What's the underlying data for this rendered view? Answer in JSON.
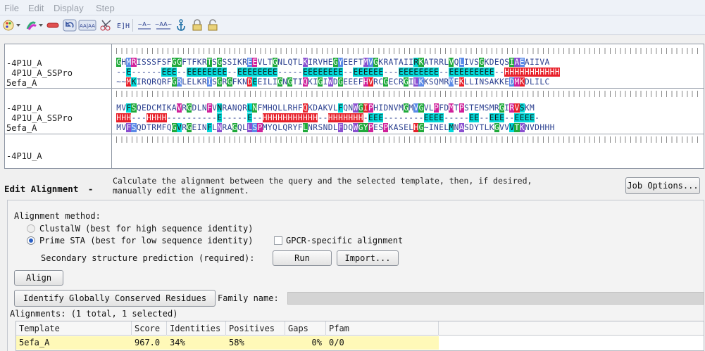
{
  "menu": [
    "File",
    "Edit",
    "Display",
    "Step"
  ],
  "toolbar": {
    "icons": [
      "palette-icon",
      "color-scheme-icon",
      "minus-link-icon",
      "undo-icon",
      "aa-hyphen-icon",
      "scissors-icon",
      "bracket-text-icon",
      "align-gap-icon",
      "align-gap2-icon",
      "anchor-icon",
      "lock-icon",
      "unlock-icon"
    ],
    "labels": {
      "aaaa": "AA|AA",
      "eh": "E]H",
      "ar1": "~A~",
      "ar2": "~AA~"
    }
  },
  "sequence_panel": {
    "blocks": [
      {
        "names": [
          "-4P1U_A",
          " 4P1U_A_SSPro",
          "5efa_A"
        ],
        "rows": [
          "GHMRISSSFSFGGFTFKRTSGSSIKREEVLTGNLQTLKIRVHEGYEEFTMVGKRATAIIRKATRRLVQLIVSGKDEQSIAEAIIVA",
          "--E------EEE--EEEEEEEE--EEEEEEEE-----EEEEEEEE--EEEEEE---EEEEEEEE--EEEEEEEEE--HHHHHHHHHHH",
          "~~MKIRQRQRFGRLELKRISGRGFKNDEEILIGNGTIQKIGIWDGEEEFHVRCGECRGILKKSQMRMEKLLINSAKKEDMKDLILC"
        ]
      },
      {
        "names": [
          "-4P1U_A",
          " 4P1U_A_SSPro",
          "5efa_A"
        ],
        "rows": [
          "MVFSQEDCMIKAVRGDLNFVNRANQRLNFMHQLLRHFQKDAKVLFQNWGIPHIDNVMGMVGVLPFDMTPSTEMSMRGIRVSKM",
          "HHH---HHHH----------E-----E--HHHHHHHHHHH--HHHHHHH-EEE--------EEEE-----EE--EEE--EEEE-",
          "MVFSQDTRMFQGVRGEINFLNRAGQLLSPMYQLQRYFLNRSNDLFDQWGYPESPKASELHG~INELMNASDYTLKGVVVTKNVDHHH"
        ]
      },
      {
        "names": [
          "-4P1U_A"
        ],
        "rows": []
      }
    ]
  },
  "edit_alignment": {
    "title": "Edit Alignment",
    "dash": "-",
    "description_line1": "Calculate the alignment between the query and the selected template, then, if desired,",
    "description_line2": "manually edit the alignment.",
    "job_options_label": "Job Options..."
  },
  "alignment_method": {
    "label": "Alignment method:",
    "options": [
      {
        "label": "ClustalW (best for high sequence identity)",
        "selected": false
      },
      {
        "label": "Prime STA (best for low sequence identity)",
        "selected": true
      }
    ],
    "gpcr_label": "GPCR-specific alignment",
    "gpcr_checked": false,
    "ss_label": "Secondary structure prediction (required):",
    "run_label": "Run",
    "import_label": "Import...",
    "align_label": "Align"
  },
  "conserved": {
    "button_label": "Identify Globally Conserved Residues",
    "family_label": "Family name:",
    "family_value": ""
  },
  "alignments": {
    "summary": "Alignments: (1 total, 1 selected)",
    "columns": [
      "Template",
      "Score",
      "Identities",
      "Positives",
      "Gaps",
      "Pfam"
    ],
    "rows": [
      {
        "template": "5efa_A",
        "score": "967.0",
        "identities": "34%",
        "positives": "58%",
        "gaps": "0%",
        "pfam": "0/0"
      }
    ]
  },
  "colors": {
    "helix": "#e8202a",
    "strand": "#00d8d8",
    "green": "#1faa3a",
    "purple": "#8a4fd0",
    "magenta": "#d0209a",
    "blue": "#5a8ae8",
    "selected_row": "#fff9b8"
  }
}
